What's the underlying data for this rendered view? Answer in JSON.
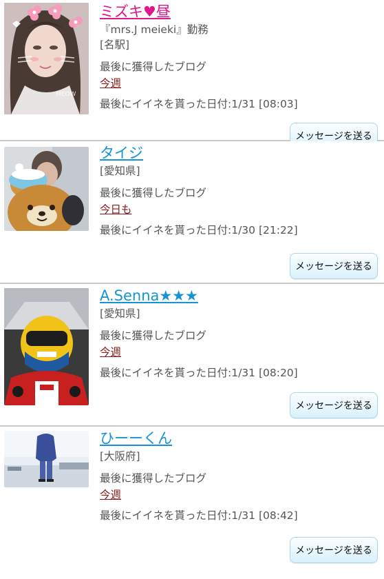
{
  "colors": {
    "name_pink": "#e0168c",
    "name_blue": "#1493d8",
    "blog_link": "#8a1a1a",
    "button_bg": "#d9f1fb",
    "divider": "#c8c8c8"
  },
  "members": [
    {
      "name": "ミズキ♥昼",
      "workplace": "『mrs.J meieki』勤務",
      "area": "[名駅]",
      "blog_label": "最後に獲得したブログ",
      "blog_period": "今週",
      "last_like": "最後にイイネを貰った日付:1/31 [08:03]",
      "button_label": "メッセージを送る",
      "avatar_icon": "profile-photo-selfie-filter-icon"
    },
    {
      "name": "タイジ",
      "area": "[愛知県]",
      "blog_label": "最後に獲得したブログ",
      "blog_period": "今日も",
      "last_like": "最後にイイネを貰った日付:1/30 [21:22]",
      "button_label": "メッセージを送る",
      "avatar_icon": "profile-photo-bear-plush-icon"
    },
    {
      "name": "A.Senna★★★",
      "area": "[愛知県]",
      "blog_label": "最後に獲得したブログ",
      "blog_period": "今週",
      "last_like": "最後にイイネを貰った日付:1/31 [08:20]",
      "button_label": "メッセージを送る",
      "avatar_icon": "profile-photo-racing-helmet-icon"
    },
    {
      "name": "ひーーくん",
      "area": "[大阪府]",
      "blog_label": "最後に獲得したブログ",
      "blog_period": "今週",
      "last_like": "最後にイイネを貰った日付:1/31 [08:42]",
      "button_label": "メッセージを送る",
      "avatar_icon": "profile-photo-person-outdoors-icon"
    }
  ]
}
